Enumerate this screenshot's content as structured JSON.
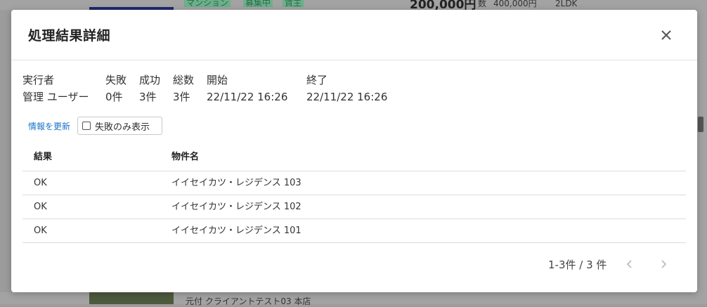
{
  "background": {
    "tags": [
      "マンション",
      "募集中",
      "賃主"
    ],
    "price": "200,000円",
    "info_label": "数",
    "info_value": "400,000円",
    "layout": "2LDK",
    "address": "元付 クライアントテスト03 本店"
  },
  "modal": {
    "title": "処理結果詳細",
    "summary": {
      "labels": [
        "実行者",
        "失敗",
        "成功",
        "総数",
        "開始",
        "終了"
      ],
      "values": [
        "管理 ユーザー",
        "0件",
        "3件",
        "3件",
        "22/11/22 16:26",
        "22/11/22 16:26"
      ]
    },
    "refresh_label": "情報を更新",
    "filter_label": "失敗のみ表示",
    "table": {
      "headers": [
        "結果",
        "物件名"
      ],
      "rows": [
        [
          "OK",
          "イイセイカツ・レジデンス 103"
        ],
        [
          "OK",
          "イイセイカツ・レジデンス 102"
        ],
        [
          "OK",
          "イイセイカツ・レジデンス 101"
        ]
      ]
    },
    "pagination": "1-3件 / 3 件"
  }
}
